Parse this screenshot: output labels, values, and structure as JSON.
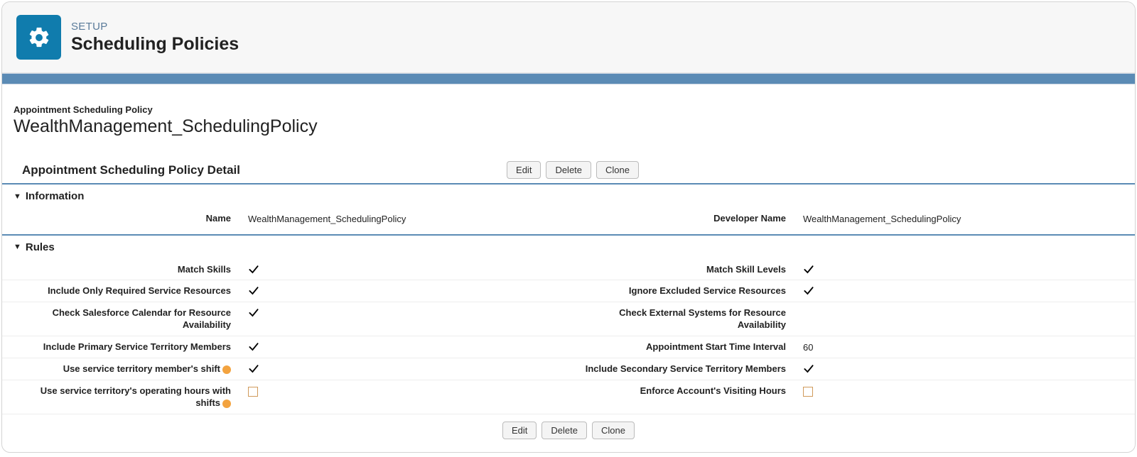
{
  "header": {
    "eyebrow": "SETUP",
    "title": "Scheduling Policies"
  },
  "record": {
    "type": "Appointment Scheduling Policy",
    "name": "WealthManagement_SchedulingPolicy"
  },
  "detail": {
    "heading": "Appointment Scheduling Policy Detail",
    "buttons": {
      "edit": "Edit",
      "delete": "Delete",
      "clone": "Clone"
    }
  },
  "sections": {
    "information": {
      "title": "Information",
      "name_label": "Name",
      "name_value": "WealthManagement_SchedulingPolicy",
      "devname_label": "Developer Name",
      "devname_value": "WealthManagement_SchedulingPolicy"
    },
    "rules": {
      "title": "Rules",
      "match_skills": "Match Skills",
      "match_skill_levels": "Match Skill Levels",
      "include_only_required": "Include Only Required Service Resources",
      "ignore_excluded": "Ignore Excluded Service Resources",
      "check_sf_calendar": "Check Salesforce Calendar for Resource Availability",
      "check_external": "Check External Systems for Resource Availability",
      "include_primary": "Include Primary Service Territory Members",
      "appt_start_interval": "Appointment Start Time Interval",
      "appt_start_interval_value": "60",
      "use_member_shift": "Use service territory member's shift",
      "include_secondary": "Include Secondary Service Territory Members",
      "use_operating_hours": "Use service territory's operating hours with shifts",
      "enforce_visiting": "Enforce Account's Visiting Hours"
    }
  }
}
